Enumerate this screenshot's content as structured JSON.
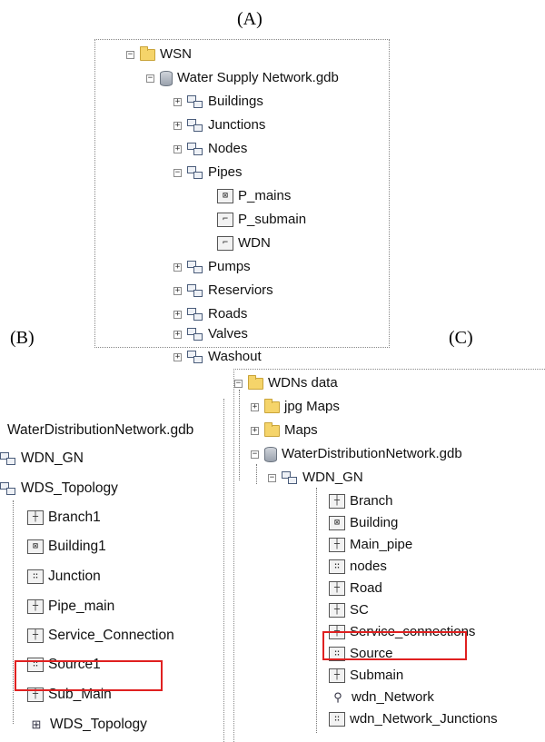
{
  "labels": {
    "a": "(A)",
    "b": "(B)",
    "c": "(C)"
  },
  "panel_a": {
    "root": "WSN",
    "gdb": "Water Supply Network.gdb",
    "items": [
      "Buildings",
      "Junctions",
      "Nodes",
      "Pipes",
      "P_mains",
      "P_submain",
      "WDN",
      "Pumps",
      "Reserviors",
      "Roads",
      "Valves",
      "Washout"
    ]
  },
  "panel_b": {
    "gdb": "WaterDistributionNetwork.gdb",
    "datasets": [
      "WDN_GN",
      "WDS_Topology"
    ],
    "items": [
      "Branch1",
      "Building1",
      "Junction",
      "Pipe_main",
      "Service_Connection",
      "Source1",
      "Sub_Main",
      "WDS_Topology"
    ]
  },
  "panel_c": {
    "root": "WDNs data",
    "folders": [
      "jpg Maps",
      "Maps"
    ],
    "gdb": "WaterDistributionNetwork.gdb",
    "dataset": "WDN_GN",
    "items": [
      "Branch",
      "Building",
      "Main_pipe",
      "nodes",
      "Road",
      "SC",
      "Service_connections",
      "Source",
      "Submain",
      "wdn_Network",
      "wdn_Network_Junctions"
    ]
  },
  "icons": {
    "folder": "folder-icon",
    "geodatabase": "geodatabase-icon",
    "feature_dataset": "feature-dataset-icon",
    "line_feature_class": "line-feature-class-icon",
    "point_feature_class": "point-feature-class-icon",
    "polygon_feature_class": "polygon-feature-class-icon",
    "topology": "topology-icon",
    "network": "network-icon"
  },
  "colors": {
    "highlight": "#e02020",
    "folder": "#f5d46a"
  }
}
